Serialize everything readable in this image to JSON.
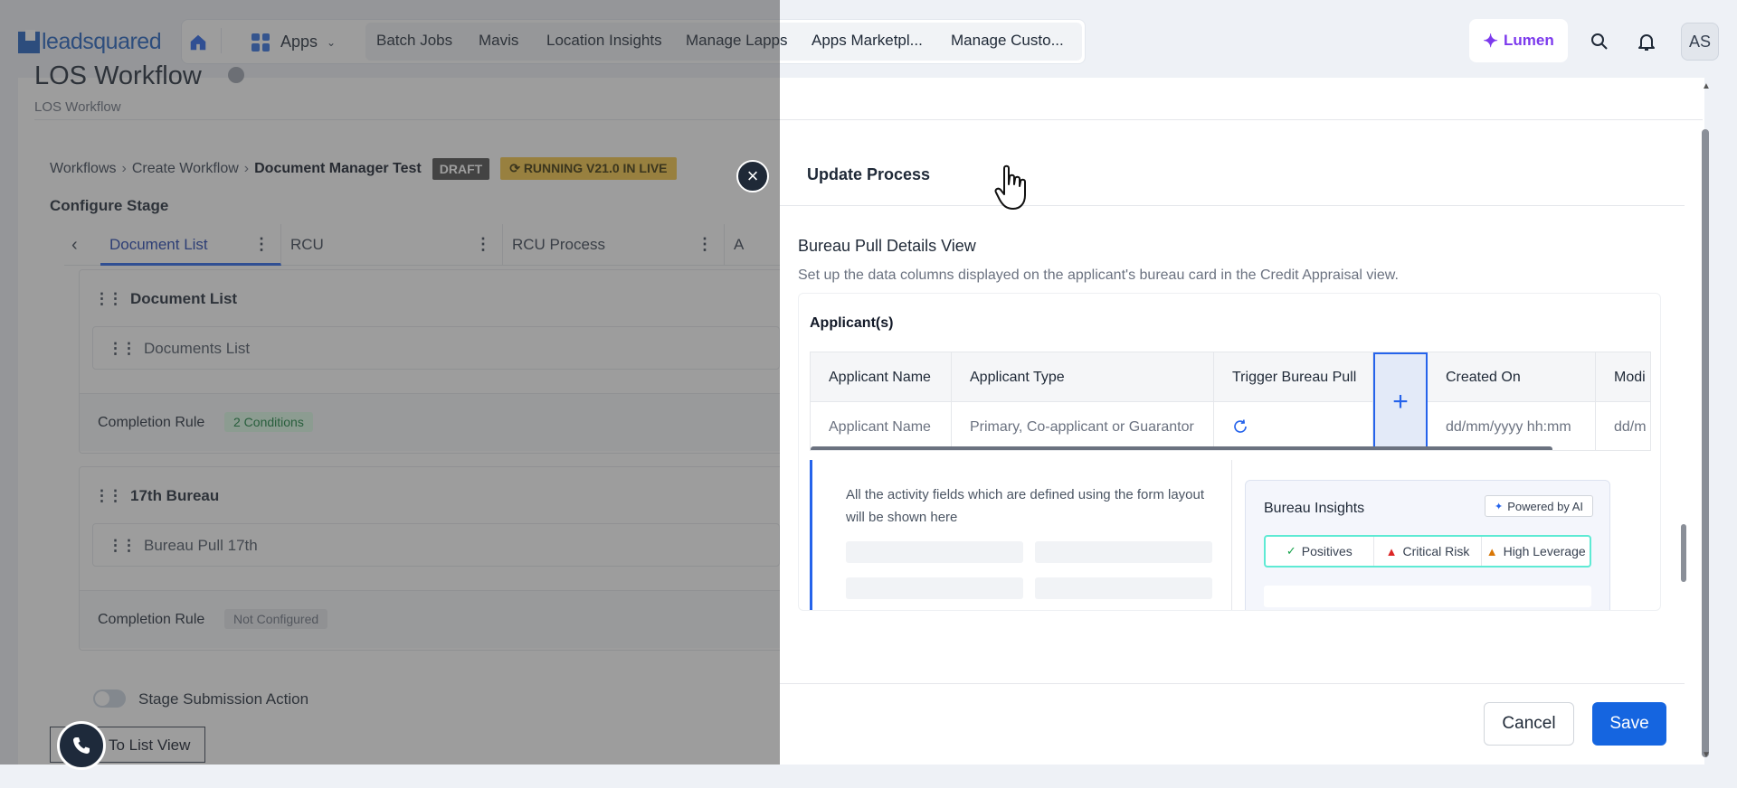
{
  "brand": {
    "logo_text": "leadsquared"
  },
  "nav": {
    "apps_label": "Apps",
    "links": [
      "Batch Jobs",
      "Mavis",
      "Location Insights",
      "Manage Lapps",
      "Apps Marketpl...",
      "Manage Custo..."
    ],
    "lumen_label": "Lumen",
    "avatar_initials": "AS"
  },
  "page": {
    "title": "LOS Workflow",
    "subtitle": "LOS Workflow"
  },
  "workflow": {
    "breadcrumbs": [
      "Workflows",
      "Create Workflow",
      "Document Manager Test"
    ],
    "badge_draft": "DRAFT",
    "badge_running": "RUNNING V21.0 IN LIVE",
    "configure_stage": "Configure Stage",
    "tabs": [
      "Document List",
      "RCU",
      "RCU Process"
    ],
    "tab_overflow": "A",
    "cards": [
      {
        "title": "Document List",
        "item": "Documents List",
        "completion_label": "Completion Rule",
        "completion_value": "2 Conditions"
      },
      {
        "title": "17th Bureau",
        "item": "Bureau Pull 17th",
        "completion_label": "Completion Rule",
        "completion_value": "Not Configured"
      }
    ],
    "stage_submission": "Stage Submission Action",
    "list_view_button": "To List View"
  },
  "drawer": {
    "title": "Update Process",
    "section_title": "Bureau Pull Details View",
    "section_desc": "Set up the data columns displayed on the applicant's bureau card in the Credit Appraisal view.",
    "applicants_title": "Applicant(s)",
    "columns": [
      "Applicant Name",
      "Applicant Type",
      "Trigger Bureau Pull",
      "Created On",
      "Modi"
    ],
    "row": [
      "Applicant Name",
      "Primary, Co-applicant or Guarantor",
      "",
      "dd/mm/yyyy hh:mm",
      "dd/m"
    ],
    "preview_text": "All the activity fields which are defined using the form layout will be shown here",
    "insights": {
      "title": "Bureau Insights",
      "badge": "Powered by AI",
      "tabs": [
        "Positives",
        "Critical Risk",
        "High Leverage"
      ]
    },
    "cancel_label": "Cancel",
    "save_label": "Save"
  },
  "colors": {
    "accent": "#1565e0",
    "draft_badge": "#4b4b4b",
    "running_badge": "#f5c443",
    "lumen": "#7c3aed"
  }
}
